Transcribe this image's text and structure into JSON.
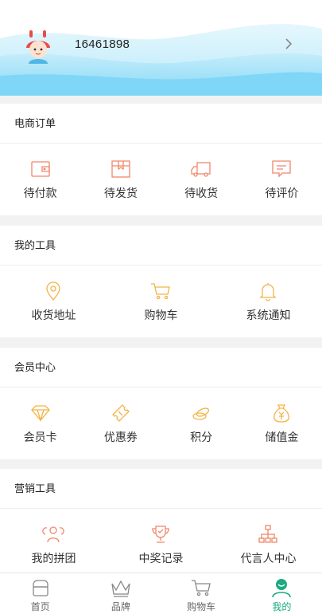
{
  "user": {
    "id": "16461898"
  },
  "sections": {
    "orders": {
      "title": "电商订单",
      "items": [
        {
          "label": "待付款",
          "icon": "wallet-icon"
        },
        {
          "label": "待发货",
          "icon": "package-icon"
        },
        {
          "label": "待收货",
          "icon": "truck-icon"
        },
        {
          "label": "待评价",
          "icon": "comment-icon"
        }
      ]
    },
    "tools": {
      "title": "我的工具",
      "items": [
        {
          "label": "收货地址",
          "icon": "location-pin-icon"
        },
        {
          "label": "购物车",
          "icon": "cart-icon"
        },
        {
          "label": "系统通知",
          "icon": "bell-icon"
        }
      ]
    },
    "member": {
      "title": "会员中心",
      "items": [
        {
          "label": "会员卡",
          "icon": "diamond-icon"
        },
        {
          "label": "优惠券",
          "icon": "ticket-icon"
        },
        {
          "label": "积分",
          "icon": "coins-icon"
        },
        {
          "label": "储值金",
          "icon": "money-bag-icon"
        }
      ]
    },
    "marketing": {
      "title": "营销工具",
      "items": [
        {
          "label": "我的拼团",
          "icon": "group-icon"
        },
        {
          "label": "中奖记录",
          "icon": "trophy-icon"
        },
        {
          "label": "代言人中心",
          "icon": "org-chart-icon"
        }
      ]
    }
  },
  "tabbar": {
    "items": [
      {
        "label": "首页",
        "icon": "home-icon"
      },
      {
        "label": "品牌",
        "icon": "crown-icon"
      },
      {
        "label": "购物车",
        "icon": "cart-icon"
      },
      {
        "label": "我的",
        "icon": "user-icon"
      }
    ],
    "active_color": "#1aab80"
  },
  "colors": {
    "orders_icon": "#f0866a",
    "tools_icon": "#f3b347",
    "member_icon": "#f3b347",
    "marketing_icon": "#f0866a",
    "header_wave": "#7fd6f7"
  }
}
